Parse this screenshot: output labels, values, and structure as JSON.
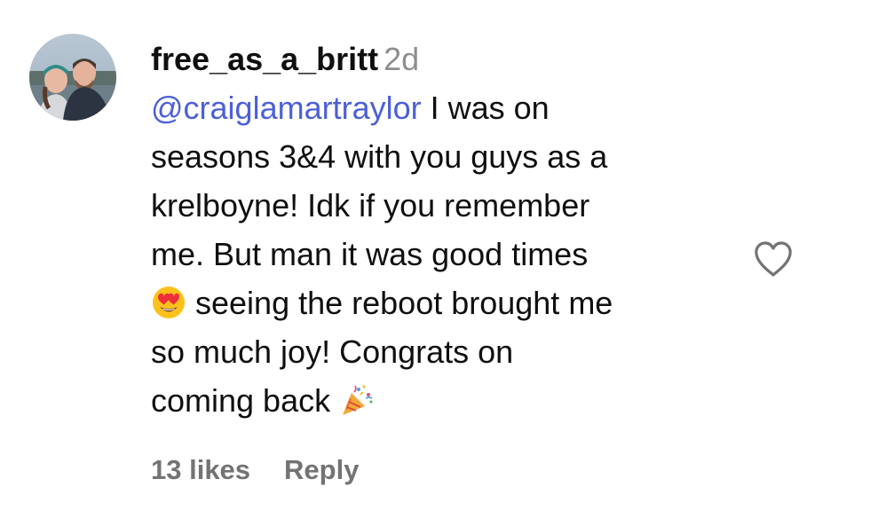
{
  "comment": {
    "username": "free_as_a_britt",
    "timestamp": "2d",
    "mention": "@craiglamartraylor",
    "lines": [
      " I was on",
      "seasons 3&4 with you guys as a",
      "krelboyne! Idk if you remember",
      "me. But man it was good times",
      " seeing the reboot brought me",
      "so much joy! Congrats on",
      "coming back "
    ],
    "emojis": {
      "heart_eyes": "smiling-face-with-heart-eyes-icon",
      "party_popper": "party-popper-icon"
    },
    "likes_label": "13 likes",
    "reply_label": "Reply",
    "like_icon": "heart-outline-icon"
  },
  "colors": {
    "mention": "#4c5fd7",
    "secondary_text": "#8e8e8e",
    "action_text": "#737373",
    "primary_text": "#0f0f0f"
  }
}
